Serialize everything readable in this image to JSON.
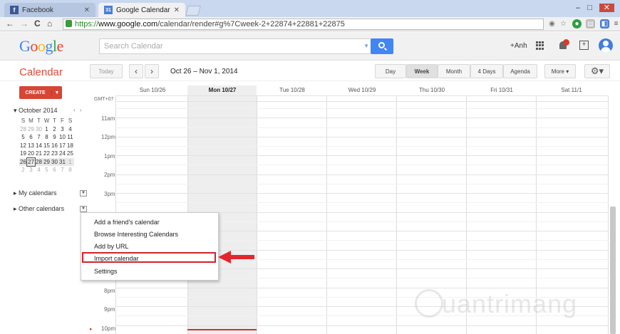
{
  "browser": {
    "tabs": [
      {
        "label": "Facebook",
        "active": false,
        "icon": "facebook-icon"
      },
      {
        "label": "Google Calendar",
        "active": true,
        "icon": "calendar-icon",
        "icon_text": "31"
      }
    ],
    "url": {
      "scheme": "https://",
      "host": "www.google.com",
      "path": "/calendar/render#g%7Cweek-2+22874+22881+22875"
    }
  },
  "header": {
    "logo": "Google",
    "search_placeholder": "Search Calendar",
    "user": "+Anh"
  },
  "toolbar": {
    "app_title": "Calendar",
    "today": "Today",
    "prev": "‹",
    "next": "›",
    "date_range": "Oct 26 – Nov 1, 2014",
    "views": [
      "Day",
      "Week",
      "Month",
      "4 Days",
      "Agenda"
    ],
    "selected_view": "Week",
    "more": "More ▾",
    "settings": "⚙▾"
  },
  "sidebar": {
    "create_label": "CREATE",
    "month_title": "October 2014",
    "dow": [
      "S",
      "M",
      "T",
      "W",
      "T",
      "F",
      "S"
    ],
    "weeks": [
      [
        "28",
        "29",
        "30",
        "1",
        "2",
        "3",
        "4"
      ],
      [
        "5",
        "6",
        "7",
        "8",
        "9",
        "10",
        "11"
      ],
      [
        "12",
        "13",
        "14",
        "15",
        "16",
        "17",
        "18"
      ],
      [
        "19",
        "20",
        "21",
        "22",
        "23",
        "24",
        "25"
      ],
      [
        "26",
        "27",
        "28",
        "29",
        "30",
        "31",
        "1"
      ],
      [
        "2",
        "3",
        "4",
        "5",
        "6",
        "7",
        "8"
      ]
    ],
    "my_calendars": "My calendars",
    "other_calendars": "Other calendars"
  },
  "grid": {
    "timezone": "GMT+07",
    "columns": [
      "Sun 10/26",
      "Mon 10/27",
      "Tue 10/28",
      "Wed 10/29",
      "Thu 10/30",
      "Fri 10/31",
      "Sat 11/1"
    ],
    "hours": [
      {
        "label": "11am"
      },
      {
        "label": "12pm"
      },
      {
        "label": "1pm"
      },
      {
        "label": "2pm"
      },
      {
        "label": "3pm"
      },
      {
        "label": "8pm"
      },
      {
        "label": "9pm"
      },
      {
        "label": "10pm"
      }
    ]
  },
  "menu": {
    "items": [
      "Add a friend's calendar",
      "Browse Interesting Calendars",
      "Add by URL",
      "Import calendar",
      "Settings"
    ],
    "highlighted": "Import calendar"
  },
  "watermark": "uantrimang",
  "colors": {
    "accent": "#dd4b39",
    "create": "#d74534",
    "search_button": "#4285f4",
    "annotation": "#e3262d"
  }
}
